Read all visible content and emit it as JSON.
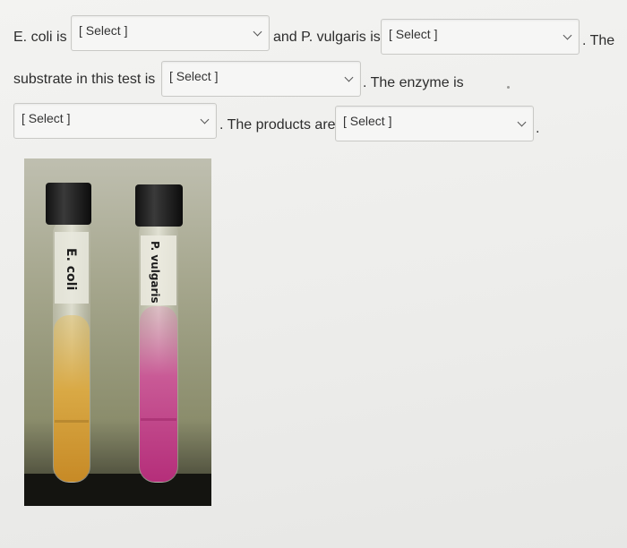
{
  "question": {
    "line1": {
      "prefix": "E. coli is",
      "middle": "and P. vulgaris is",
      "suffix": ". The"
    },
    "line2": {
      "prefix": "substrate in this test is",
      "suffix": ". The enzyme is"
    },
    "line3": {
      "suffix": ". The products are",
      "end": "."
    }
  },
  "dropdowns": {
    "ecoli_result": {
      "value": "[ Select ]"
    },
    "pvulgaris_result": {
      "value": "[ Select ]"
    },
    "substrate": {
      "value": "[ Select ]"
    },
    "enzyme": {
      "value": "[ Select ]"
    },
    "products": {
      "value": "[ Select ]"
    }
  },
  "photo": {
    "tube_left_label": "E. coli",
    "tube_right_label": "P. vulgaris",
    "colors": {
      "left_broth": "#d8a83c",
      "right_broth": "#c24a8e",
      "caps": "#1a1a1a"
    }
  }
}
